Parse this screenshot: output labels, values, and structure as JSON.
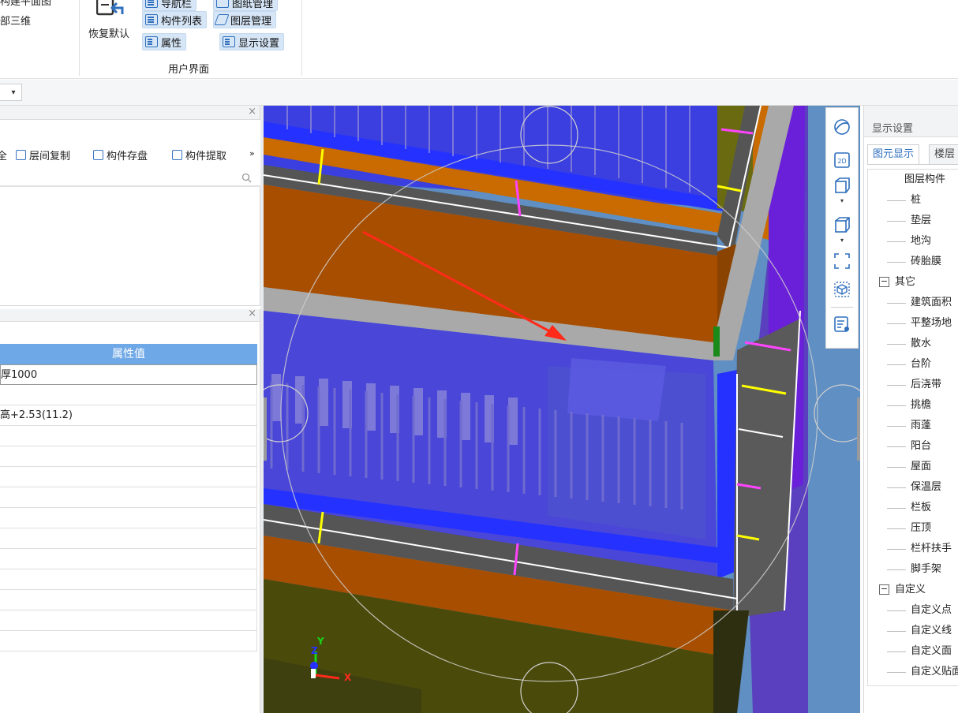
{
  "ribbon": {
    "partial_top": "构建平面图",
    "partial_3d": "部三维",
    "restore_label": "恢复默认",
    "btn_nav_tree": "导航栏",
    "btn_drawing_mgmt": "图纸管理",
    "btn_component_list": "构件列表",
    "btn_layer_mgmt": "图层管理",
    "btn_properties": "属性",
    "btn_display_settings": "显示设置",
    "group_label": "用户界面"
  },
  "toolbar2": {
    "dropdown_value": ""
  },
  "component_panel": {
    "partial_btn": "全",
    "btn_floor_copy": "层间复制",
    "btn_save_component": "构件存盘",
    "btn_extract_component": "构件提取",
    "more": "»"
  },
  "property_panel": {
    "header": "属性值",
    "rows": [
      "厚1000",
      "",
      "高+2.53(11.2)",
      "",
      "",
      "",
      "",
      "",
      "",
      "",
      "",
      "",
      "",
      ""
    ]
  },
  "display_settings": {
    "title": "显示设置",
    "tabs": [
      "图元显示",
      "楼层"
    ],
    "tree": [
      {
        "label": "图层构件",
        "kind": "header"
      },
      {
        "label": "桩",
        "kind": "leaf"
      },
      {
        "label": "垫层",
        "kind": "leaf"
      },
      {
        "label": "地沟",
        "kind": "leaf"
      },
      {
        "label": "砖胎膜",
        "kind": "leaf"
      },
      {
        "label": "其它",
        "kind": "group"
      },
      {
        "label": "建筑面积",
        "kind": "leaf"
      },
      {
        "label": "平整场地",
        "kind": "leaf"
      },
      {
        "label": "散水",
        "kind": "leaf"
      },
      {
        "label": "台阶",
        "kind": "leaf"
      },
      {
        "label": "后浇带",
        "kind": "leaf"
      },
      {
        "label": "挑檐",
        "kind": "leaf"
      },
      {
        "label": "雨蓬",
        "kind": "leaf"
      },
      {
        "label": "阳台",
        "kind": "leaf"
      },
      {
        "label": "屋面",
        "kind": "leaf"
      },
      {
        "label": "保温层",
        "kind": "leaf"
      },
      {
        "label": "栏板",
        "kind": "leaf"
      },
      {
        "label": "压顶",
        "kind": "leaf"
      },
      {
        "label": "栏杆扶手",
        "kind": "leaf"
      },
      {
        "label": "脚手架",
        "kind": "leaf"
      },
      {
        "label": "自定义",
        "kind": "group"
      },
      {
        "label": "自定义点",
        "kind": "leaf"
      },
      {
        "label": "自定义线",
        "kind": "leaf"
      },
      {
        "label": "自定义面",
        "kind": "leaf"
      },
      {
        "label": "自定义贴面",
        "kind": "leaf"
      }
    ]
  },
  "axes": {
    "x": "X",
    "y": "Y",
    "z": "Z"
  },
  "colors": {
    "accent_blue": "#2f6fbd",
    "header_blue": "#6fa8e6",
    "arrow_red": "#ff2a1a"
  }
}
